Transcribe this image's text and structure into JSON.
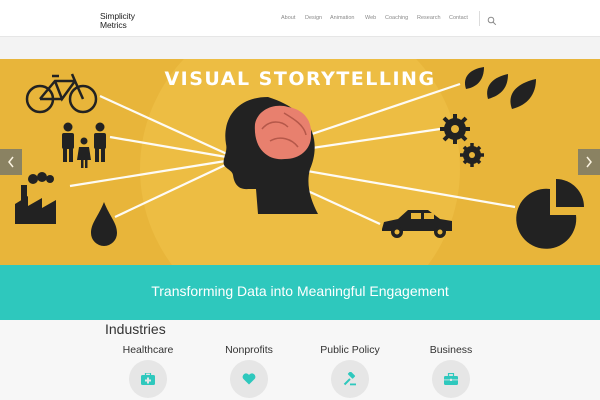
{
  "header": {
    "logo_line1": "Simplicity",
    "logo_line2": "Metrics",
    "nav": [
      {
        "label": "About"
      },
      {
        "label": "Design"
      },
      {
        "label": "Animation"
      },
      {
        "label": "Web"
      },
      {
        "label": "Coaching"
      },
      {
        "label": "Research"
      },
      {
        "label": "Contact"
      }
    ],
    "search_icon": "search-icon"
  },
  "hero": {
    "title": "VISUAL STORYTELLING",
    "background_color": "#e8b53a",
    "icons": [
      "bicycle-icon",
      "people-icon",
      "factory-icon",
      "drop-icon",
      "head-brain-icon",
      "leaves-icon",
      "gears-icon",
      "car-icon",
      "pie-chart-icon"
    ],
    "prev_icon": "chevron-left-icon",
    "next_icon": "chevron-right-icon"
  },
  "banner": {
    "text": "Transforming Data into Meaningful Engagement",
    "color": "#2ec8bd"
  },
  "industries": {
    "title": "Industries",
    "items": [
      {
        "label": "Healthcare",
        "icon": "medical-kit-icon"
      },
      {
        "label": "Nonprofits",
        "icon": "heart-icon"
      },
      {
        "label": "Public Policy",
        "icon": "gavel-icon"
      },
      {
        "label": "Business",
        "icon": "briefcase-icon"
      }
    ],
    "icon_color": "#2ec8bd"
  }
}
